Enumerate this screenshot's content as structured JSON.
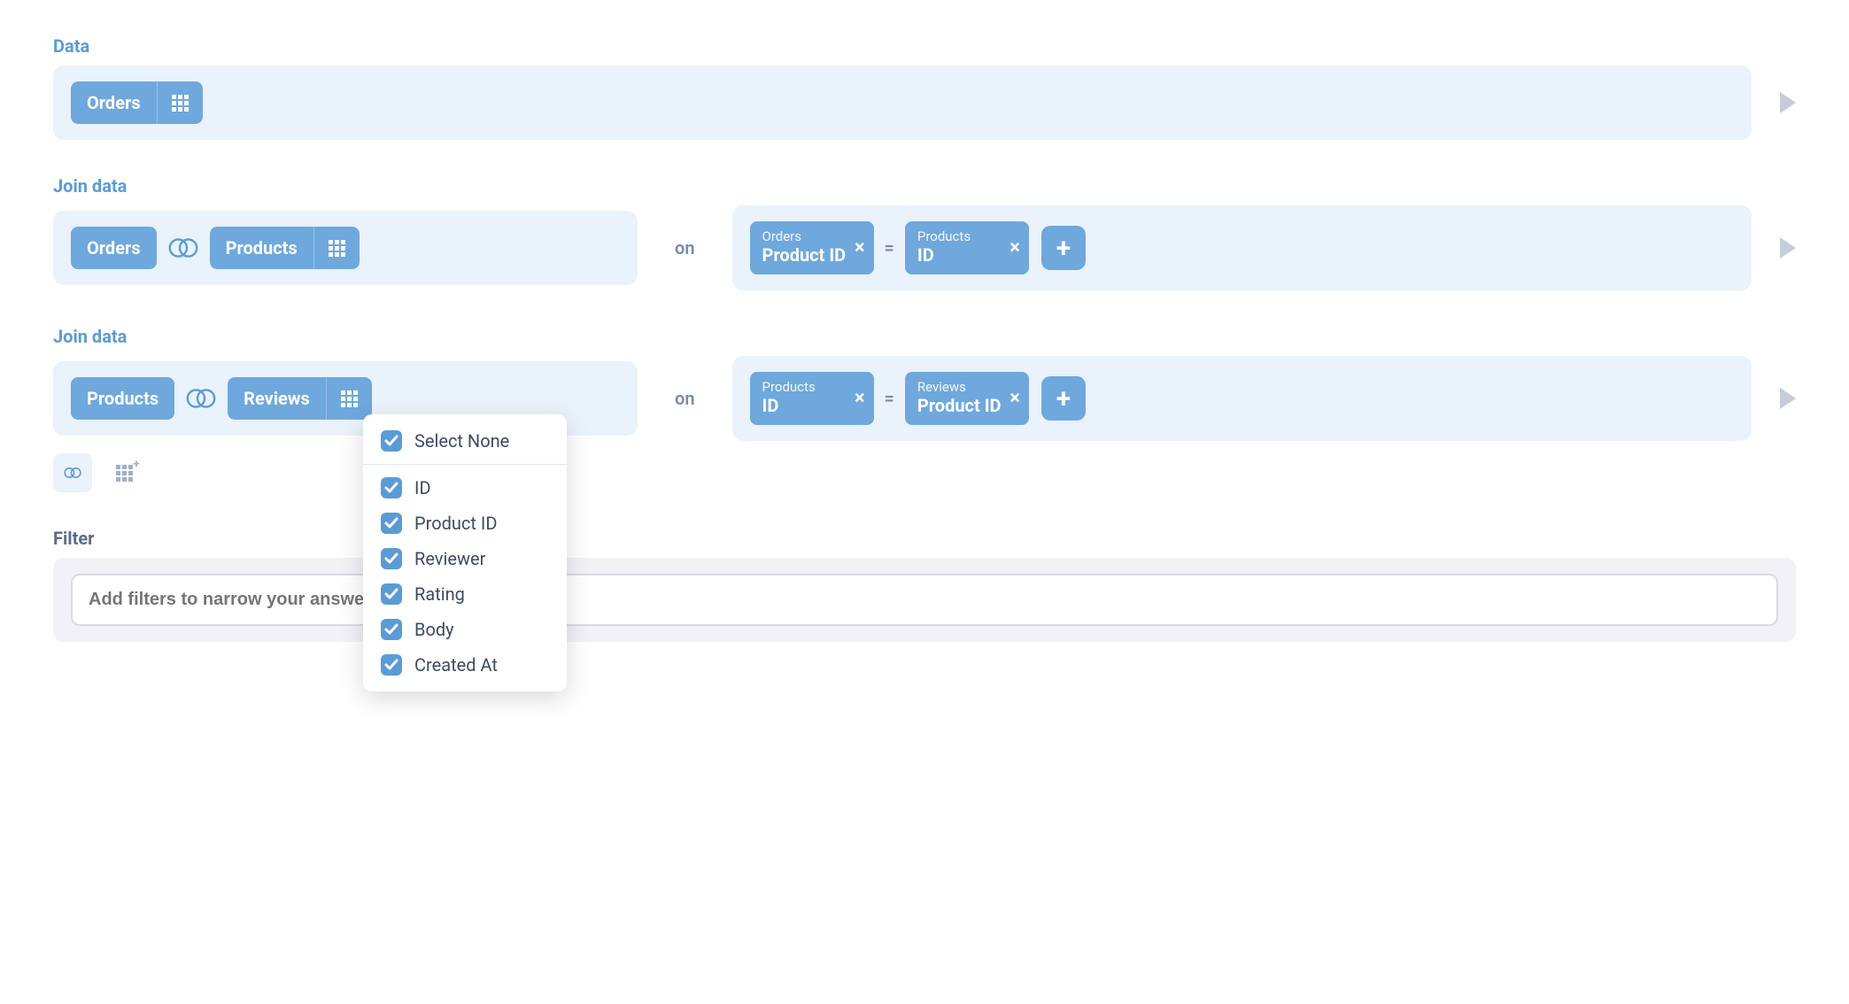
{
  "data_section": {
    "label": "Data",
    "table": "Orders"
  },
  "joins": [
    {
      "label": "Join data",
      "left_table": "Orders",
      "right_table": "Products",
      "on_text": "on",
      "left_cond": {
        "table": "Orders",
        "column": "Product ID"
      },
      "eq": "=",
      "right_cond": {
        "table": "Products",
        "column": "ID"
      }
    },
    {
      "label": "Join data",
      "left_table": "Products",
      "right_table": "Reviews",
      "on_text": "on",
      "left_cond": {
        "table": "Products",
        "column": "ID"
      },
      "eq": "=",
      "right_cond": {
        "table": "Reviews",
        "column": "Product ID"
      }
    }
  ],
  "columns_popover": {
    "header": "Select None",
    "items": [
      "ID",
      "Product ID",
      "Reviewer",
      "Rating",
      "Body",
      "Created At"
    ]
  },
  "filter": {
    "label": "Filter",
    "placeholder": "Add filters to narrow your answer"
  }
}
